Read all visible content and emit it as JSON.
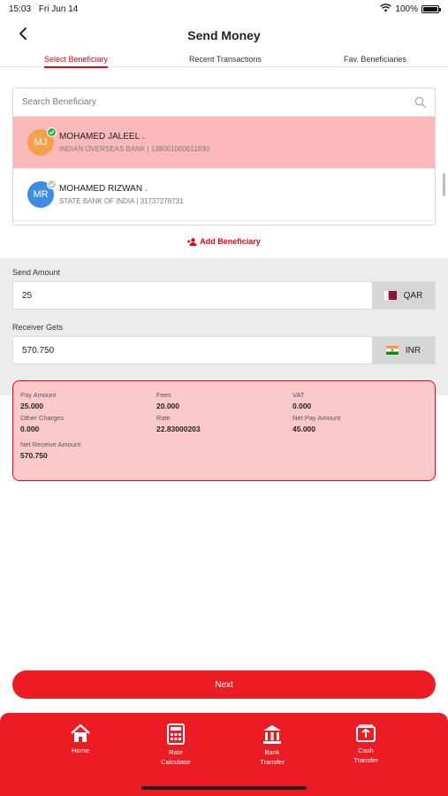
{
  "status_bar": {
    "time": "15:03",
    "date": "Fri Jun 14",
    "battery": "100%"
  },
  "header": {
    "title": "Send Money"
  },
  "tabs": [
    {
      "label": "Select Beneficiary",
      "active": true
    },
    {
      "label": "Recent Transactions",
      "active": false
    },
    {
      "label": "Fav. Beneficiaries",
      "active": false
    }
  ],
  "search": {
    "placeholder": "Search Beneficiary"
  },
  "beneficiaries": [
    {
      "initials": "MJ",
      "name": "MOHAMED JALEEL .",
      "details": "INDIAN OVERSEAS BANK | 138001000011830",
      "selected": true,
      "avatar_color": "#f5a04a"
    },
    {
      "initials": "MR",
      "name": "MOHAMED RIZWAN .",
      "details": "STATE BANK OF INDIA | 31737278731",
      "selected": false,
      "avatar_color": "#3d8ee3"
    }
  ],
  "add_beneficiary": {
    "label": "Add Beneficiary"
  },
  "send": {
    "label": "Send Amount",
    "value": "25",
    "currency": "QAR"
  },
  "receive": {
    "label": "Receiver Gets",
    "value": "570.750",
    "currency": "INR"
  },
  "summary": {
    "pay_amount": {
      "label": "Pay Amount",
      "value": "25.000"
    },
    "fees": {
      "label": "Fees",
      "value": "20.000"
    },
    "vat": {
      "label": "VAT",
      "value": "0.000"
    },
    "other_charges": {
      "label": "Other Charges",
      "value": "0.000"
    },
    "rate": {
      "label": "Rate",
      "value": "22.83000203"
    },
    "net_pay": {
      "label": "Net Pay Amount",
      "value": "45.000"
    },
    "net_receive": {
      "label": "Net Receive Amount",
      "value": "570.750"
    }
  },
  "next_button": {
    "label": "Next"
  },
  "bottom_nav": [
    {
      "label": "Home",
      "icon": "home-icon"
    },
    {
      "label": "Rate\nCalculator",
      "icon": "calculator-icon"
    },
    {
      "label": "Bank\nTransfer",
      "icon": "bank-icon"
    },
    {
      "label": "Cash\nTransfer",
      "icon": "cash-icon"
    }
  ],
  "colors": {
    "brand_red": "#ec1c24",
    "selected_row": "#fcb9bb",
    "summary_bg": "#fcc9cb"
  }
}
